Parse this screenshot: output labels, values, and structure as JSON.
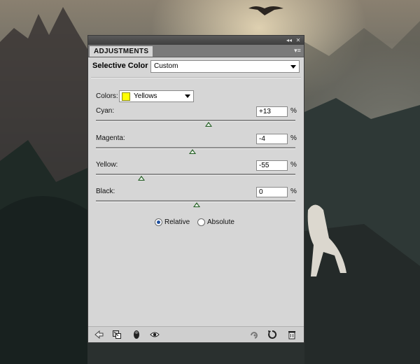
{
  "panel": {
    "tab_label": "ADJUSTMENTS",
    "adjustment_name": "Selective Color",
    "preset": "Custom",
    "colors_label": "Colors:",
    "colors_value": "Yellows",
    "swatch_color": "#ffff00",
    "sliders": [
      {
        "label": "Cyan:",
        "value": "+13",
        "pct": "%"
      },
      {
        "label": "Magenta:",
        "value": "-4",
        "pct": "%"
      },
      {
        "label": "Yellow:",
        "value": "-55",
        "pct": "%"
      },
      {
        "label": "Black:",
        "value": "0",
        "pct": "%"
      }
    ],
    "method": {
      "relative_label": "Relative",
      "absolute_label": "Absolute",
      "selected": "Relative"
    }
  }
}
